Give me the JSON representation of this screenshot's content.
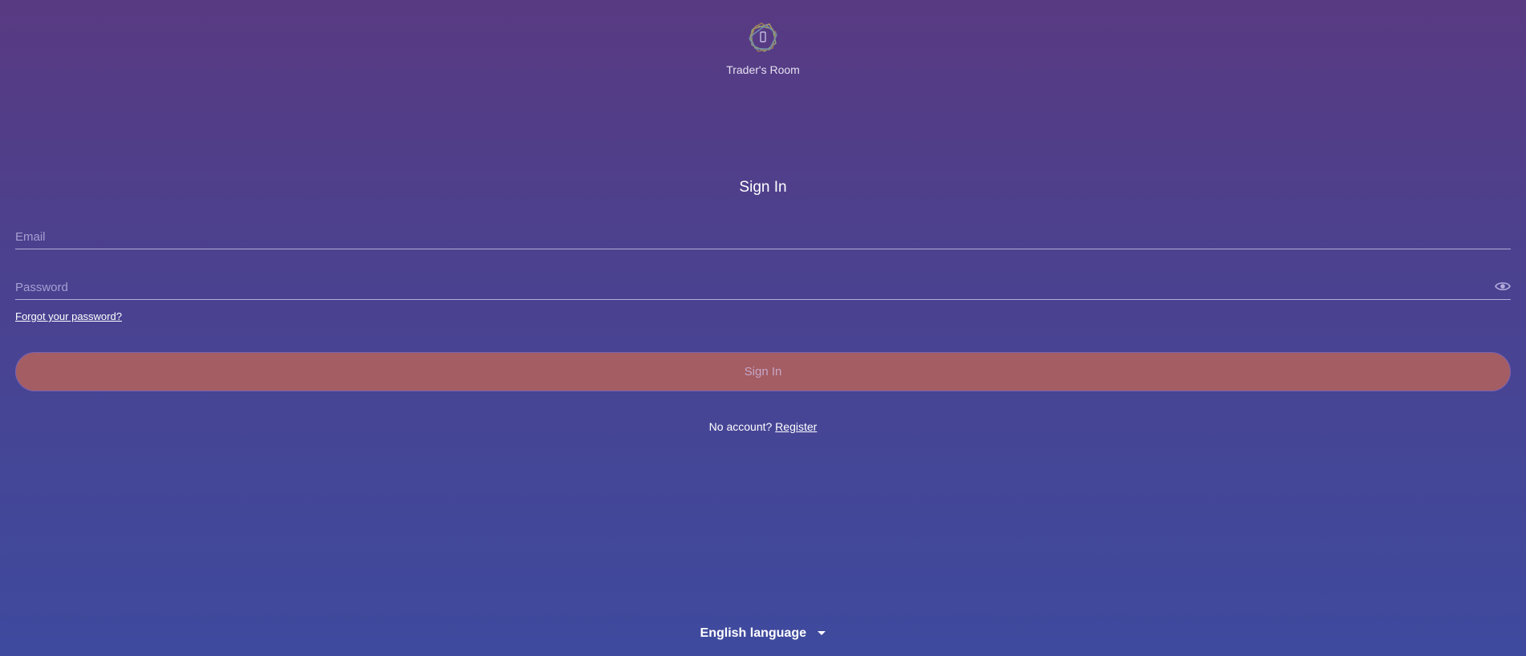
{
  "header": {
    "brand": "Trader's Room",
    "logo_icon": "brand-logo-icon"
  },
  "form": {
    "title": "Sign In",
    "email_placeholder": "Email",
    "password_placeholder": "Password",
    "password_toggle_icon": "eye-icon",
    "forgot_label": "Forgot your password?",
    "submit_label": "Sign In",
    "no_account_text": "No account?",
    "register_label": "Register"
  },
  "footer": {
    "language": "English language",
    "language_icon": "caret-down-icon"
  },
  "colors": {
    "background_top": "#583a82",
    "background_bottom": "#3e4a9e",
    "button": "#a35d63",
    "input_line": "#b4acdc"
  }
}
